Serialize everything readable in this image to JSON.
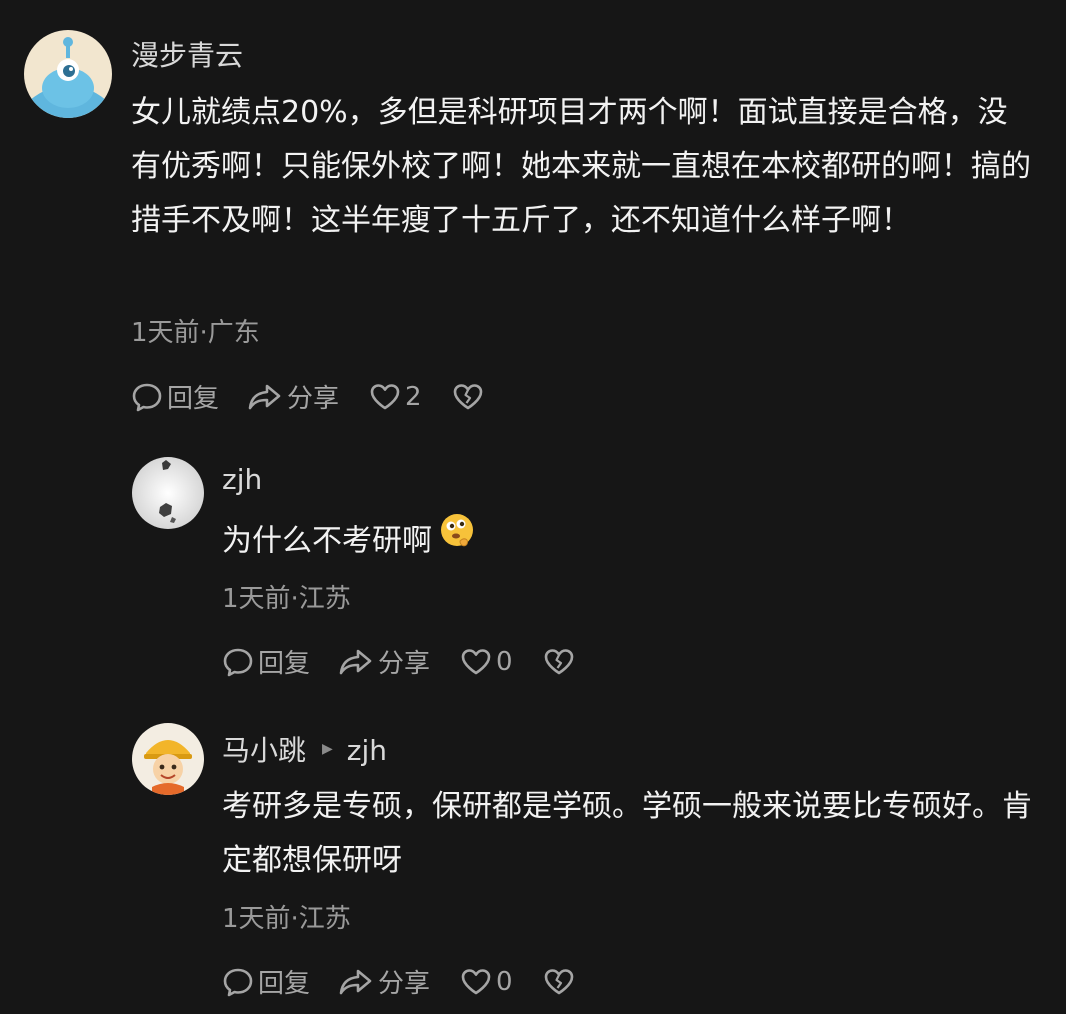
{
  "comments": [
    {
      "username": "漫步青云",
      "text": "女儿就绩点20%，多但是科研项目才两个啊！面试直接是合格，没有优秀啊！只能保外校了啊！她本来就一直想在本校都研的啊！搞的措手不及啊！这半年瘦了十五斤了，还不知道什么样子啊！",
      "meta": "1天前·广东",
      "reply_label": "回复",
      "share_label": "分享",
      "likes": "2"
    },
    {
      "username": "zjh",
      "text": "为什么不考研啊",
      "emoji": "thinking-face-emoji",
      "meta": "1天前·江苏",
      "reply_label": "回复",
      "share_label": "分享",
      "likes": "0"
    },
    {
      "username": "马小跳",
      "reply_to": "zjh",
      "text": "考研多是专硕，保研都是学硕。学硕一般来说要比专硕好。肯定都想保研呀",
      "meta": "1天前·江苏",
      "reply_label": "回复",
      "share_label": "分享",
      "likes": "0"
    }
  ],
  "icons": {
    "reply": "comment-bubble-icon",
    "share": "share-arrow-icon",
    "like": "heart-icon",
    "dislike": "broken-heart-icon"
  },
  "colors": {
    "background": "#161616",
    "text": "#f2f2f2",
    "muted": "#9a9a9a"
  }
}
